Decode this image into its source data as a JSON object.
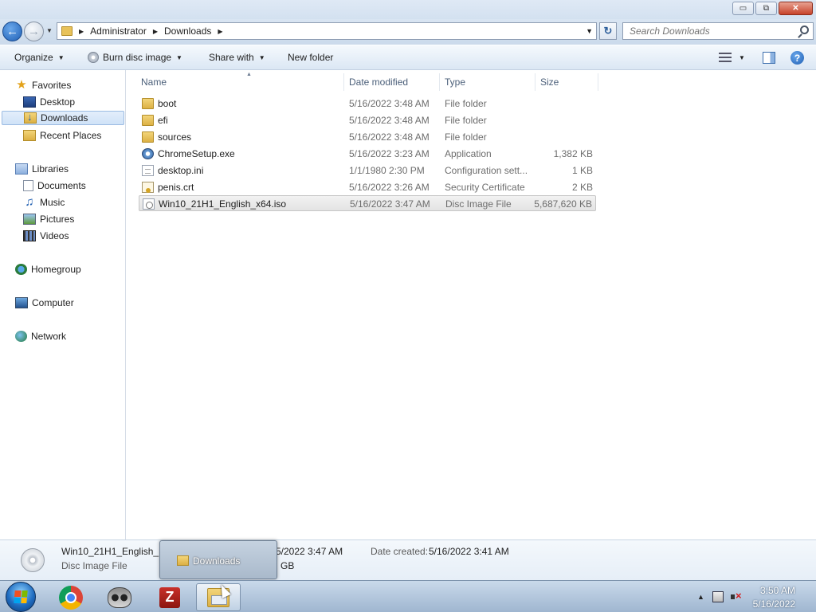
{
  "window": {
    "minimize": "▭",
    "maximize": "⧉",
    "close": "✕"
  },
  "address": {
    "crumbs": [
      "Administrator",
      "Downloads"
    ],
    "search_placeholder": "Search Downloads",
    "refresh_glyph": "↻"
  },
  "toolbar": {
    "organize": "Organize",
    "burn": "Burn disc image",
    "share": "Share with",
    "new_folder": "New folder",
    "help": "?"
  },
  "nav": {
    "favorites": "Favorites",
    "desktop": "Desktop",
    "downloads": "Downloads",
    "recent": "Recent Places",
    "libraries": "Libraries",
    "documents": "Documents",
    "music": "Music",
    "pictures": "Pictures",
    "videos": "Videos",
    "homegroup": "Homegroup",
    "computer": "Computer",
    "network": "Network",
    "selected": "Downloads"
  },
  "columns": {
    "name": "Name",
    "date": "Date modified",
    "type": "Type",
    "size": "Size"
  },
  "files": [
    {
      "name": "boot",
      "date": "5/16/2022 3:48 AM",
      "type": "File folder",
      "size": "",
      "icon": "folder-icon"
    },
    {
      "name": "efi",
      "date": "5/16/2022 3:48 AM",
      "type": "File folder",
      "size": "",
      "icon": "folder-icon"
    },
    {
      "name": "sources",
      "date": "5/16/2022 3:48 AM",
      "type": "File folder",
      "size": "",
      "icon": "folder-icon"
    },
    {
      "name": "ChromeSetup.exe",
      "date": "5/16/2022 3:23 AM",
      "type": "Application",
      "size": "1,382 KB",
      "icon": "exe-icon"
    },
    {
      "name": "desktop.ini",
      "date": "1/1/1980 2:30 PM",
      "type": "Configuration sett...",
      "size": "1 KB",
      "icon": "ini-file-icon"
    },
    {
      "name": "penis.crt",
      "date": "5/16/2022 3:26 AM",
      "type": "Security Certificate",
      "size": "2 KB",
      "icon": "certificate-icon"
    },
    {
      "name": "Win10_21H1_English_x64.iso",
      "date": "5/16/2022 3:47 AM",
      "type": "Disc Image File",
      "size": "5,687,620 KB",
      "icon": "disc-image-icon",
      "selected": true
    }
  ],
  "details": {
    "name": "Win10_21H1_English_",
    "type": "Disc Image File",
    "modified_fragment": "5/2022 3:47 AM",
    "size_fragment": "GB",
    "created_label": "Date created:",
    "created": "5/16/2022 3:41 AM"
  },
  "taskbar_preview": {
    "label": "Downloads"
  },
  "taskbar": {
    "apps": [
      "chrome",
      "raccoon-app",
      "filezilla",
      "windows-explorer"
    ],
    "time": "3:50 AM",
    "date": "5/16/2022"
  }
}
